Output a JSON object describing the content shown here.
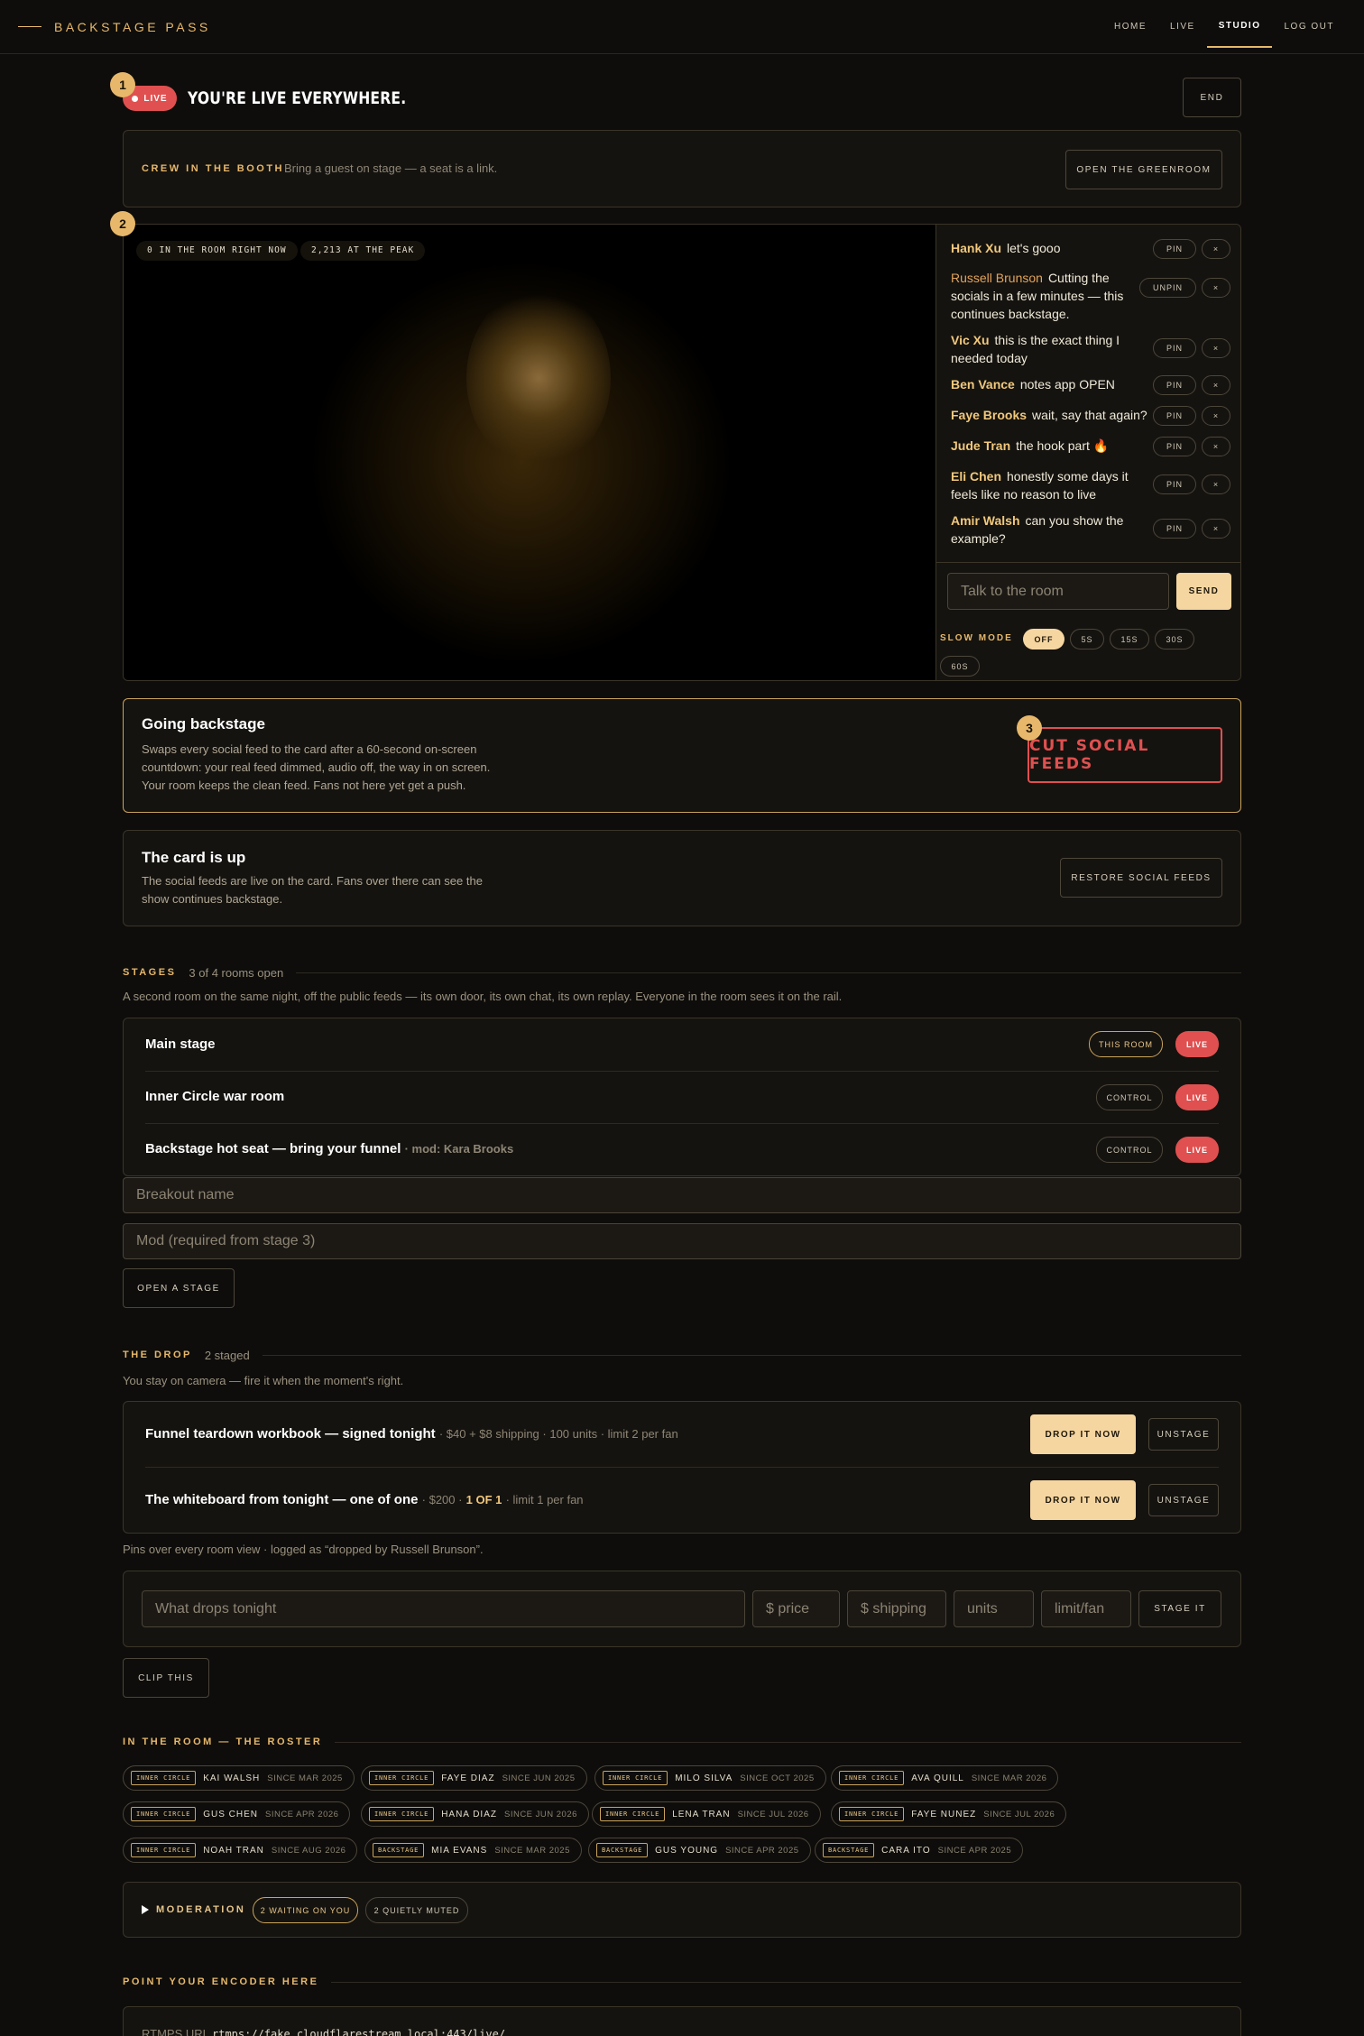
{
  "brand": "BACKSTAGE PASS",
  "nav": [
    {
      "label": "HOME",
      "active": false
    },
    {
      "label": "LIVE",
      "active": false
    },
    {
      "label": "STUDIO",
      "active": true
    },
    {
      "label": "LOG OUT",
      "active": false
    }
  ],
  "header": {
    "badge": "1",
    "live_label": "LIVE",
    "title": "YOU'RE LIVE EVERYWHERE.",
    "end_label": "END"
  },
  "crew": {
    "label": "CREW IN THE BOOTH",
    "text": "Bring a guest on stage — a seat is a link.",
    "button": "OPEN THE GREENROOM"
  },
  "stream": {
    "badge": "2",
    "stats": [
      "0 IN THE ROOM RIGHT NOW",
      "2,213 AT THE PEAK"
    ],
    "chat": [
      {
        "name": "Hank Xu",
        "text": "let's gooo",
        "action": "PIN",
        "pinned": false
      },
      {
        "name": "Russell Brunson",
        "text": "Cutting the socials in a few minutes — this continues backstage.",
        "action": "UNPIN",
        "pinned": true
      },
      {
        "name": "Vic Xu",
        "text": "this is the exact thing I needed today",
        "action": "PIN",
        "pinned": false
      },
      {
        "name": "Ben Vance",
        "text": "notes app OPEN",
        "action": "PIN",
        "pinned": false
      },
      {
        "name": "Faye Brooks",
        "text": "wait, say that again?",
        "action": "PIN",
        "pinned": false
      },
      {
        "name": "Jude Tran",
        "text": "the hook part 🔥",
        "action": "PIN",
        "pinned": false
      },
      {
        "name": "Eli Chen",
        "text": "honestly some days it feels like no reason to live",
        "action": "PIN",
        "pinned": false
      },
      {
        "name": "Amir Walsh",
        "text": "can you show the example?",
        "action": "PIN",
        "pinned": false
      }
    ],
    "remove_glyph": "×",
    "chat_placeholder": "Talk to the room",
    "send_label": "SEND",
    "slow_mode_label": "SLOW MODE",
    "slow_options": [
      "OFF",
      "5S",
      "15S",
      "30S",
      "60S"
    ],
    "slow_selected": "OFF"
  },
  "backstage": {
    "badge": "3",
    "title": "Going backstage",
    "text": "Swaps every social feed to the card after a 60-second on-screen countdown: your real feed dimmed, audio off, the way in on screen. Your room keeps the clean feed. Fans not here yet get a push.",
    "button": "CUT SOCIAL FEEDS"
  },
  "card": {
    "title": "The card is up",
    "text": "The social feeds are live on the card. Fans over there can see the show continues backstage.",
    "button": "RESTORE SOCIAL FEEDS"
  },
  "stages": {
    "label": "STAGES",
    "sub": "3 of 4 rooms open",
    "desc": "A second room on the same night, off the public feeds — its own door, its own chat, its own replay. Everyone in the room sees it on the rail.",
    "rows": [
      {
        "name": "Main stage",
        "mod": "",
        "action": "THIS ROOM",
        "status": "LIVE"
      },
      {
        "name": "Inner Circle war room",
        "mod": "",
        "action": "CONTROL",
        "status": "LIVE"
      },
      {
        "name": "Backstage hot seat — bring your funnel",
        "mod": "· mod: Kara Brooks",
        "action": "CONTROL",
        "status": "LIVE"
      }
    ],
    "name_placeholder": "Breakout name",
    "mod_placeholder": "Mod (required from stage 3)",
    "open_button": "OPEN A STAGE"
  },
  "drop": {
    "label": "THE DROP",
    "sub": "2 staged",
    "desc": "You stay on camera — fire it when the moment's right.",
    "items": [
      {
        "name": "Funnel teardown workbook — signed tonight",
        "pre": "· $40 + $8 shipping · 100 units · limit 2 per fan",
        "highlight": "",
        "post": ""
      },
      {
        "name": "The whiteboard from tonight — one of one",
        "pre": "· $200 ·",
        "highlight": "1 OF 1",
        "post": "· limit 1 per fan"
      }
    ],
    "drop_button": "DROP IT NOW",
    "unstage_button": "UNSTAGE",
    "note": "Pins over every room view · logged as “dropped by Russell Brunson”.",
    "form": {
      "what": "What drops tonight",
      "price": "$ price",
      "shipping": "$ shipping",
      "units": "units",
      "limit": "limit/fan",
      "button": "STAGE IT"
    },
    "clip_button": "CLIP THIS"
  },
  "roster": {
    "label": "IN THE ROOM — THE ROSTER",
    "members": [
      {
        "tier": "INNER CIRCLE",
        "name": "KAI WALSH",
        "since": "SINCE MAR 2025"
      },
      {
        "tier": "INNER CIRCLE",
        "name": "FAYE DIAZ",
        "since": "SINCE JUN 2025"
      },
      {
        "tier": "INNER CIRCLE",
        "name": "MILO SILVA",
        "since": "SINCE OCT 2025"
      },
      {
        "tier": "INNER CIRCLE",
        "name": "AVA QUILL",
        "since": "SINCE MAR 2026"
      },
      {
        "tier": "INNER CIRCLE",
        "name": "GUS CHEN",
        "since": "SINCE APR 2026"
      },
      {
        "tier": "INNER CIRCLE",
        "name": "HANA DIAZ",
        "since": "SINCE JUN 2026"
      },
      {
        "tier": "INNER CIRCLE",
        "name": "LENA TRAN",
        "since": "SINCE JUL 2026"
      },
      {
        "tier": "INNER CIRCLE",
        "name": "FAYE NUNEZ",
        "since": "SINCE JUL 2026"
      },
      {
        "tier": "INNER CIRCLE",
        "name": "NOAH TRAN",
        "since": "SINCE AUG 2026"
      },
      {
        "tier": "BACKSTAGE",
        "name": "MIA EVANS",
        "since": "SINCE MAR 2025"
      },
      {
        "tier": "BACKSTAGE",
        "name": "GUS YOUNG",
        "since": "SINCE APR 2025"
      },
      {
        "tier": "BACKSTAGE",
        "name": "CARA ITO",
        "since": "SINCE APR 2025"
      }
    ]
  },
  "moderation": {
    "label": "MODERATION",
    "waiting": "2 WAITING ON YOU",
    "muted": "2 QUIETLY MUTED"
  },
  "encoder": {
    "label": "POINT YOUR ENCODER HERE",
    "rtmps_label": "RTMPS URL",
    "rtmps_value": "rtmps://fake.cloudflarestream.local:443/live/"
  },
  "colors": {
    "accent": "#e7b86b",
    "live": "#e05050",
    "cream": "#f6d6a0"
  }
}
